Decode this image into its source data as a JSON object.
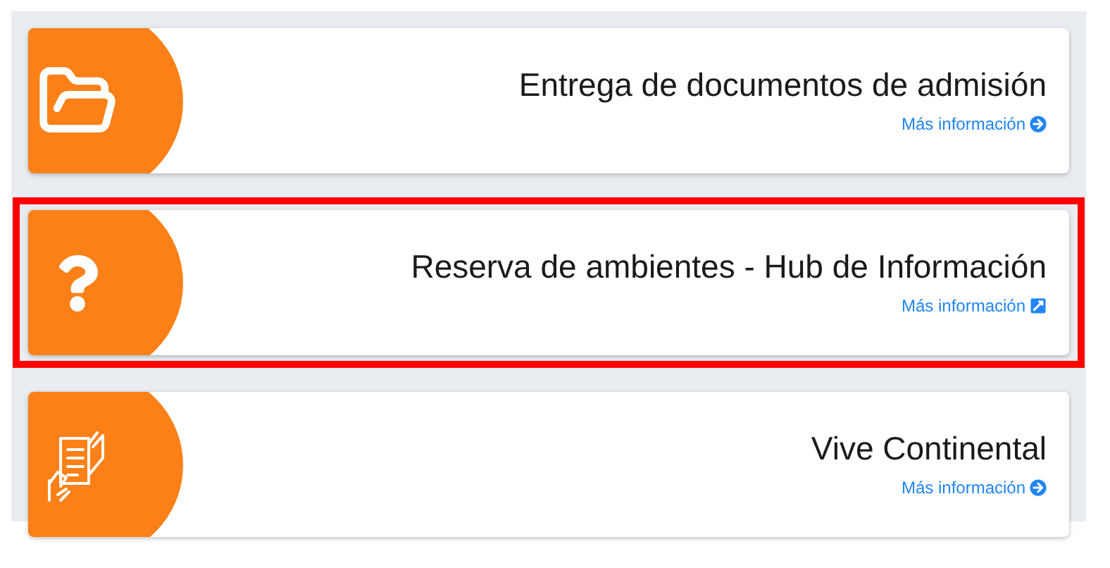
{
  "cards": [
    {
      "kind": "folder",
      "title": "Entrega de documentos de admisión",
      "link": {
        "label": "Más información",
        "kind": "internal"
      },
      "selected": false
    },
    {
      "kind": "question",
      "title": "Reserva de ambientes - Hub de Información",
      "link": {
        "label": "Más información",
        "kind": "external"
      },
      "selected": true
    },
    {
      "kind": "document",
      "title": "Vive Continental",
      "link": {
        "label": "Más información",
        "kind": "internal"
      },
      "selected": false
    }
  ]
}
